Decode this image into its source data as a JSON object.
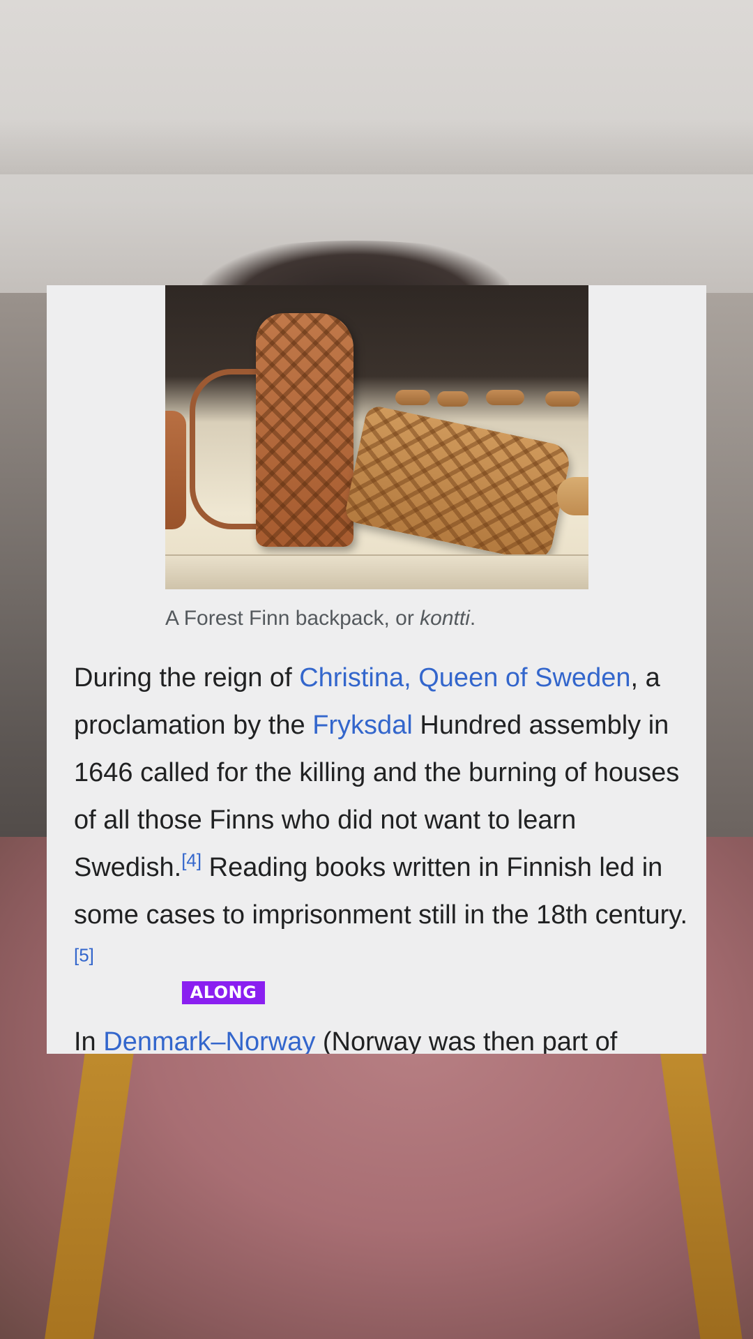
{
  "figure": {
    "caption_prefix": "A Forest Finn backpack, or ",
    "caption_term": "kontti",
    "caption_suffix": "."
  },
  "paragraph1": {
    "t1": "During the reign of ",
    "link_christina": "Christina, Queen of Sweden",
    "t2": ", a proclamation by the ",
    "link_fryksdal": "Fryksdal",
    "t3": " Hundred assembly in 1646 called for the killing and the burning of houses of all those Finns who did not want to learn Swedish.",
    "ref4": "[4]",
    "t4": " Reading books written in Finnish led in some cases to imprisonment still in the 18th century.",
    "ref5": "[5]"
  },
  "paragraph2": {
    "t1": "In ",
    "link_denmark_norway": "Denmark–Norway",
    "t2": " (Norway was then part of"
  },
  "subtitle": {
    "word": "ALONG",
    "color": "#8a1ff0"
  }
}
